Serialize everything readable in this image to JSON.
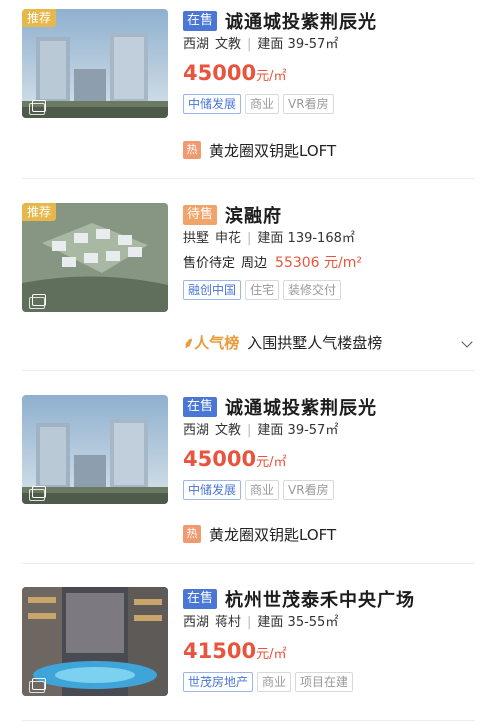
{
  "listings": [
    {
      "badge": "推荐",
      "status": "在售",
      "name": "诚通城投紫荆辰光",
      "district": "西湖",
      "area_tag": "文教",
      "build_area": "建面 39-57㎡",
      "price": "45000",
      "price_unit": "元/㎡",
      "tags": [
        "中储发展",
        "商业",
        "VR看房"
      ],
      "hot_label": "热",
      "hot_text": "黄龙圈双钥匙LOFT"
    },
    {
      "badge": "推荐",
      "status": "待售",
      "name": "滨融府",
      "district": "拱墅",
      "area_tag": "申花",
      "build_area": "建面 139-168㎡",
      "price_pending": "售价待定",
      "price_around": "周边",
      "price_around_value": "55306 元/m²",
      "tags": [
        "融创中国",
        "住宅",
        "装修交付"
      ],
      "popularity_label": "人气榜",
      "popularity_text": "入围拱墅人气楼盘榜"
    },
    {
      "status": "在售",
      "name": "诚通城投紫荆辰光",
      "district": "西湖",
      "area_tag": "文教",
      "build_area": "建面 39-57㎡",
      "price": "45000",
      "price_unit": "元/㎡",
      "tags": [
        "中储发展",
        "商业",
        "VR看房"
      ],
      "hot_label": "热",
      "hot_text": "黄龙圈双钥匙LOFT"
    },
    {
      "status": "在售",
      "name": "杭州世茂泰禾中央广场",
      "district": "西湖",
      "area_tag": "蒋村",
      "build_area": "建面 35-55㎡",
      "price": "41500",
      "price_unit": "元/㎡",
      "tags": [
        "世茂房地产",
        "商业",
        "项目在建"
      ]
    }
  ],
  "icons": {
    "album": "album-icon",
    "chevron": "chevron-down-icon",
    "popularity": "flame-icon"
  },
  "colors": {
    "status_sale": "#4a76d6",
    "status_soon": "#f0a46a",
    "price": "#e8543e",
    "recommend_badge": "#e6b84b",
    "popularity": "#e99b3a"
  }
}
